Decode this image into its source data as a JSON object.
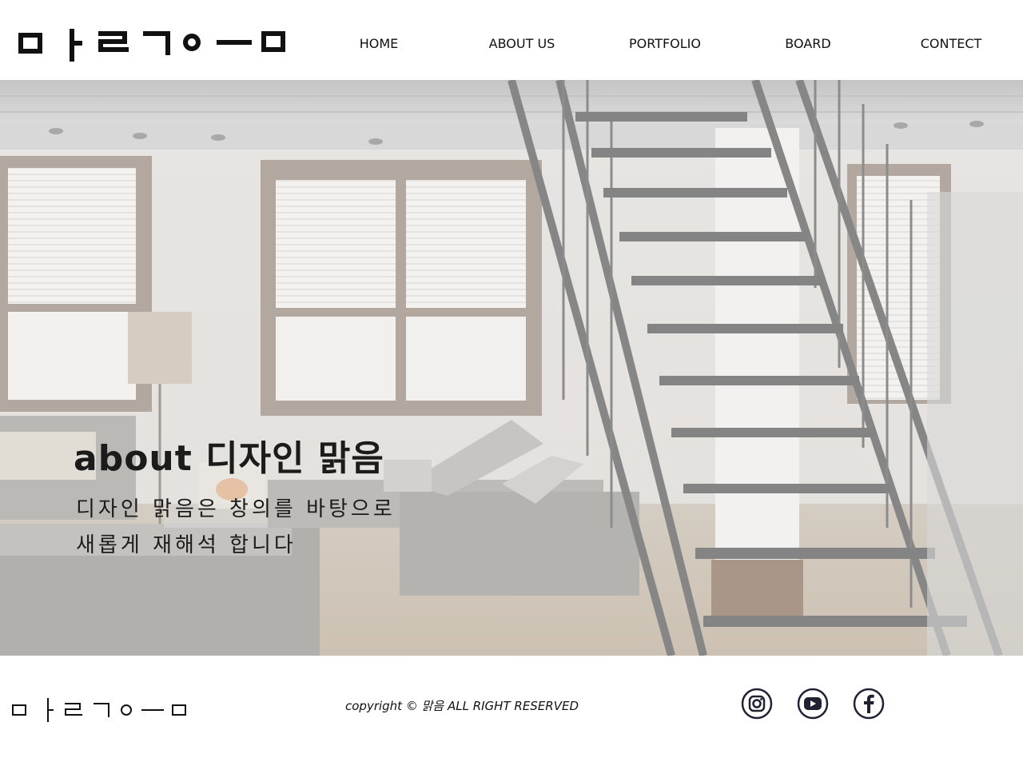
{
  "header": {
    "logo_alt": "맑음 logo",
    "nav": [
      {
        "label": "HOME"
      },
      {
        "label": "ABOUT US"
      },
      {
        "label": "PORTFOLIO"
      },
      {
        "label": "BOARD"
      },
      {
        "label": "CONTECT"
      }
    ]
  },
  "hero": {
    "title": "about  디자인 맑음",
    "lines": [
      "디자인 맑음은 창의를 바탕으로",
      "새롭게 재해석 합니다"
    ]
  },
  "footer": {
    "copyright": "copyright © 맑음 ALL RIGHT RESERVED",
    "social": [
      {
        "icon": "instagram-icon"
      },
      {
        "icon": "youtube-icon"
      },
      {
        "icon": "facebook-icon"
      }
    ]
  },
  "colors": {
    "text": "#111111",
    "social_stroke": "#1f2233"
  }
}
